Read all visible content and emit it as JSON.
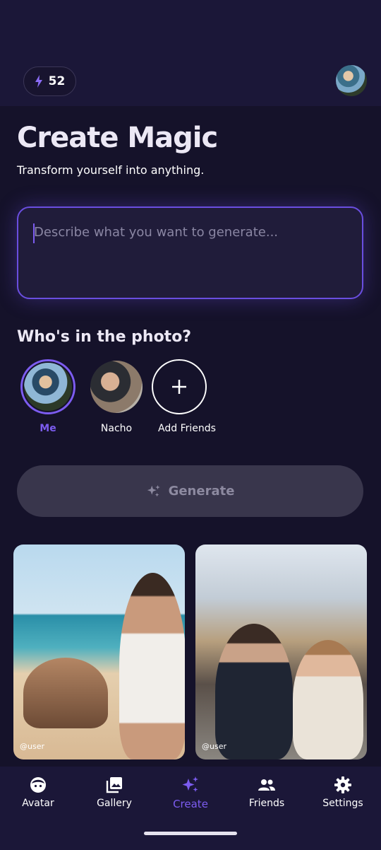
{
  "header": {
    "credits": "52",
    "credits_icon": "bolt-icon"
  },
  "main": {
    "title": "Create Magic",
    "subtitle": "Transform yourself into anything.",
    "prompt_placeholder": "Describe what you want to generate...",
    "people_title": "Who's in the photo?",
    "people": [
      {
        "label": "Me",
        "selected": true
      },
      {
        "label": "Nacho",
        "selected": false
      },
      {
        "label": "Add Friends",
        "selected": false
      }
    ],
    "generate_label": "Generate",
    "gallery": [
      {
        "tag": "@user"
      },
      {
        "tag": "@user"
      }
    ]
  },
  "nav": {
    "items": [
      {
        "label": "Avatar",
        "icon": "face-icon"
      },
      {
        "label": "Gallery",
        "icon": "photos-icon"
      },
      {
        "label": "Create",
        "icon": "sparkles-icon",
        "active": true
      },
      {
        "label": "Friends",
        "icon": "people-icon"
      },
      {
        "label": "Settings",
        "icon": "gear-icon"
      }
    ]
  },
  "colors": {
    "accent": "#7c5cf0",
    "background": "#15122a",
    "surface": "#1b1738",
    "button_disabled": "#39364c"
  }
}
